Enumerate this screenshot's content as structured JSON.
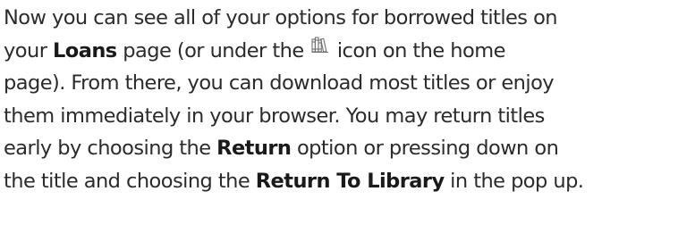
{
  "paragraph": {
    "line1": "Now you can see all of your options for borrowed titles on",
    "line2_before": "your ",
    "loans_word": "Loans",
    "line2_mid": " page (or under the ",
    "line2_after": " icon on the home",
    "shelf_icon": "bookshelf-icon",
    "line3": "page). From there, you can download most titles or enjoy",
    "line4": "them immediately in your browser. You may return titles",
    "line5_before": "early by choosing the ",
    "return_word": "Return",
    "line5_after": " option or pressing down on",
    "line6_before": "the title and choosing the ",
    "return_to_library": "Return To Library",
    "line6_after": " in the pop up."
  }
}
